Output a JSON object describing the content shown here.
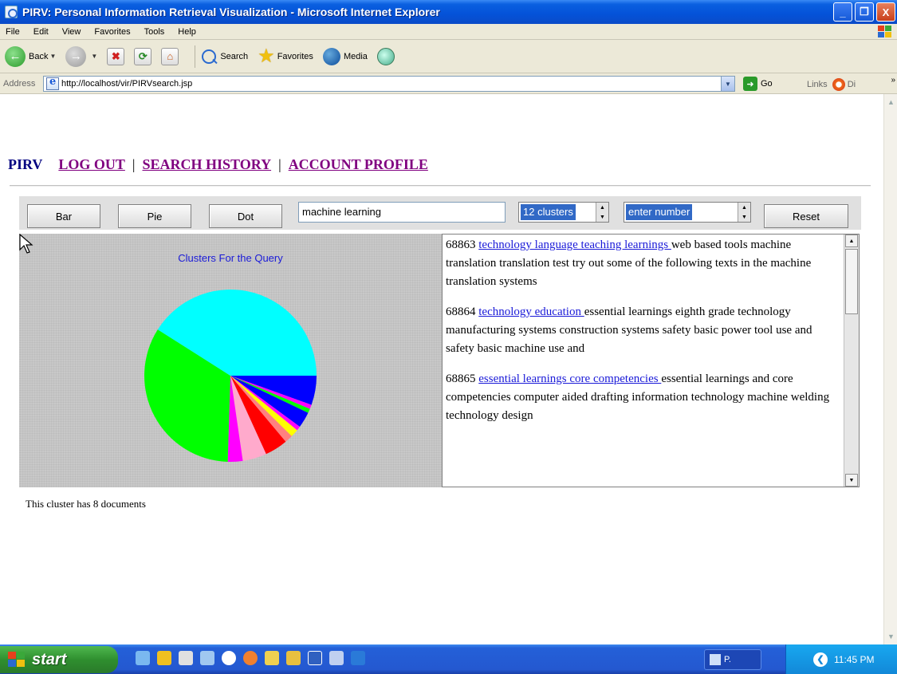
{
  "window": {
    "title": "PIRV: Personal Information Retrieval Visualization - Microsoft Internet Explorer",
    "controls": [
      "_",
      "❐",
      "X"
    ]
  },
  "menu": [
    "File",
    "Edit",
    "View",
    "Favorites",
    "Tools",
    "Help"
  ],
  "toolbar": {
    "back": "Back",
    "search": "Search",
    "favorites": "Favorites",
    "media": "Media"
  },
  "address": {
    "label": "Address",
    "url": "http://localhost/vir/PIRVsearch.jsp",
    "go": "Go",
    "links": "Links",
    "links_item": "Di",
    "more": "»"
  },
  "nav": {
    "brand": "PIRV",
    "logout": "LOG OUT",
    "history": "SEARCH HISTORY",
    "profile": "ACCOUNT PROFILE",
    "sep": "|"
  },
  "controls": {
    "bar": "Bar",
    "pie": "Pie",
    "dot": "Dot",
    "query": "machine learning",
    "clusters": "12 clusters",
    "number": "enter number",
    "reset": "Reset"
  },
  "chart_data": {
    "type": "pie",
    "title": "Clusters For the Query",
    "slices": [
      {
        "value": 5.5,
        "color": "#0000ff"
      },
      {
        "value": 0.8,
        "color": "#ff00ff"
      },
      {
        "value": 0.8,
        "color": "#00ff00"
      },
      {
        "value": 3.0,
        "color": "#0000ff"
      },
      {
        "value": 0.8,
        "color": "#ff00ff"
      },
      {
        "value": 1.5,
        "color": "#ffff00"
      },
      {
        "value": 1.5,
        "color": "#ff8080"
      },
      {
        "value": 4.3,
        "color": "#ff0000"
      },
      {
        "value": 4.5,
        "color": "#ffaacc"
      },
      {
        "value": 2.8,
        "color": "#ff00ff"
      },
      {
        "value": 33.5,
        "color": "#00ff00"
      },
      {
        "value": 41.0,
        "color": "#00ffff"
      }
    ],
    "start_angle_deg": 0,
    "direction": "clockwise"
  },
  "results": [
    {
      "id": "68863",
      "title": "technology language teaching learnings",
      "snippet": "web based tools machine translation translation test try out some of the following texts in the machine translation systems"
    },
    {
      "id": "68864",
      "title": "technology education",
      "snippet": "essential learnings eighth grade technology manufacturing systems construction systems safety basic power tool use and safety basic machine use and"
    },
    {
      "id": "68865",
      "title": "essential learnings core competencies",
      "snippet": "essential learnings and core competencies computer aided drafting information technology machine welding technology design"
    }
  ],
  "status": "This cluster has 8 documents",
  "taskbar": {
    "start": "start",
    "task": "P.",
    "time": "11:45 PM"
  }
}
